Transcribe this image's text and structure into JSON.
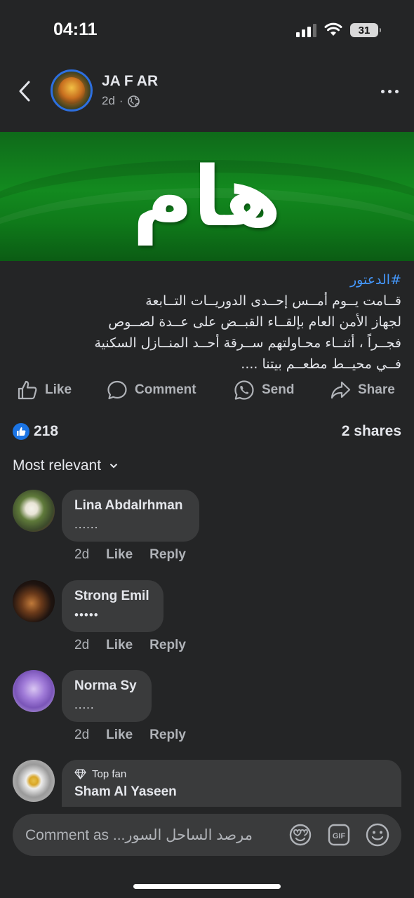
{
  "status_bar": {
    "time": "04:11",
    "battery": "31"
  },
  "post": {
    "author": "JA F AR",
    "age": "2d",
    "banner_text": "هام",
    "hashtag": "#الدعتور",
    "lines": [
      "قــامت يــوم أمــس إحــدى الدوريــات التــابعة",
      "لجهاز الأمن العام بإلقــاء القبــض على عــدة لصــوص",
      "فجــراً ، أثنــاء محـاولتهم ســرقة أحــد المنــازل السكنية",
      "فــي محيــط مطعــم بيتنا ...."
    ]
  },
  "actions": {
    "like": "Like",
    "comment": "Comment",
    "send": "Send",
    "share": "Share"
  },
  "stats": {
    "likes": "218",
    "shares": "2 shares"
  },
  "sort_label": "Most relevant",
  "comments": [
    {
      "name": "Lina Abdalrhman",
      "text": "......",
      "age": "2d",
      "like": "Like",
      "reply": "Reply"
    },
    {
      "name": "Strong Emil",
      "text": "•••••",
      "age": "2d",
      "like": "Like",
      "reply": "Reply"
    },
    {
      "name": "Norma Sy",
      "text": ".....",
      "age": "2d",
      "like": "Like",
      "reply": "Reply"
    },
    {
      "badge": "Top fan",
      "name": "Sham Al Yaseen"
    }
  ],
  "composer": {
    "placeholder": "Comment as ...مرصد الساحل السور"
  },
  "colors": {
    "background": "#242526",
    "bubble": "#3a3b3c",
    "link": "#4599ff",
    "accent": "#1b74e4",
    "banner": "#138a1f"
  }
}
